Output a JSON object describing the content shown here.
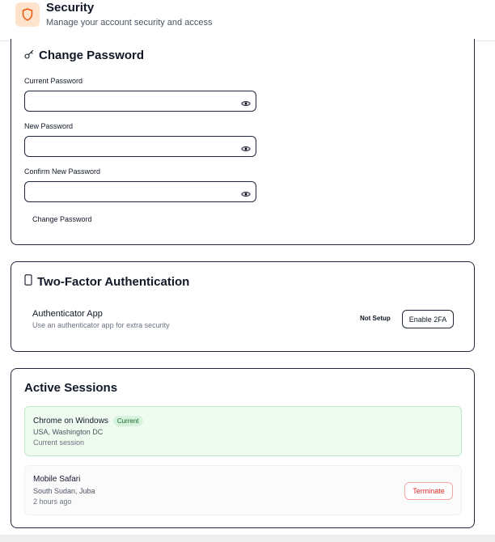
{
  "header": {
    "title": "Security",
    "subtitle": "Manage your account security and access",
    "icon": "shield-icon",
    "accent": "#fde3cc"
  },
  "change_password": {
    "title": "Change Password",
    "icon": "key-icon",
    "fields": [
      {
        "label": "Current Password",
        "value": "",
        "placeholder": ""
      },
      {
        "label": "New Password",
        "value": "",
        "placeholder": ""
      },
      {
        "label": "Confirm New Password",
        "value": "",
        "placeholder": ""
      }
    ],
    "submit_label": "Change Password"
  },
  "two_factor": {
    "title": "Two-Factor Authentication",
    "icon": "smartphone-icon",
    "method_title": "Authenticator App",
    "method_desc": "Use an authenticator app for extra security",
    "status": "Not Setup",
    "button_label": "Enable 2FA"
  },
  "sessions": {
    "title": "Active Sessions",
    "items": [
      {
        "device": "Chrome on Windows",
        "badge": "Current",
        "location": "USA, Washington DC",
        "time": "Current session"
      },
      {
        "device": "Mobile Safari",
        "location": "South Sudan, Juba",
        "time": "2 hours ago",
        "action": "Terminate"
      }
    ]
  }
}
